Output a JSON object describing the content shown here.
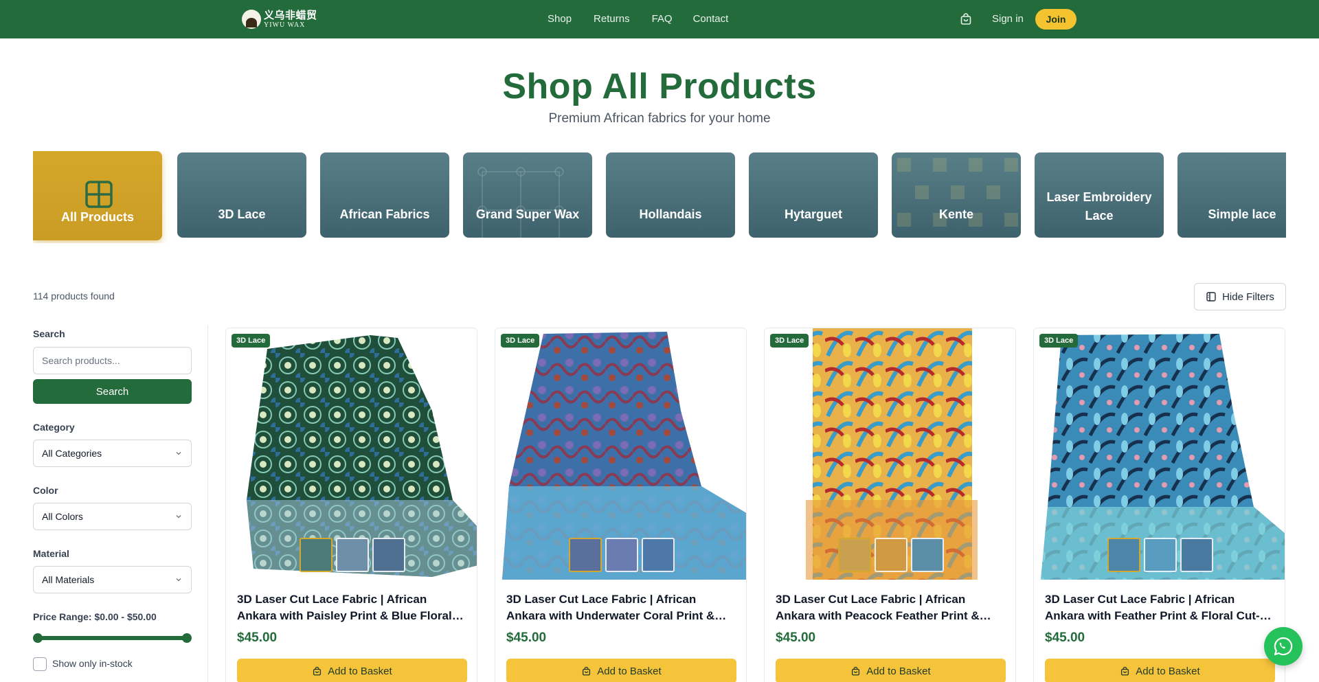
{
  "nav": {
    "logo_cn": "义乌非蜡贸",
    "logo_en": "YIWU WAX",
    "links": [
      "Shop",
      "Returns",
      "FAQ",
      "Contact"
    ],
    "signin": "Sign in",
    "join": "Join"
  },
  "header": {
    "title": "Shop All Products",
    "subtitle": "Premium African fabrics for your home"
  },
  "categories": [
    {
      "label": "All Products",
      "active": true
    },
    {
      "label": "3D Lace"
    },
    {
      "label": "African Fabrics"
    },
    {
      "label": "Grand Super Wax"
    },
    {
      "label": "Hollandais"
    },
    {
      "label": "Hytarguet"
    },
    {
      "label": "Kente"
    },
    {
      "label": "Laser Embroidery Lace"
    },
    {
      "label": "Simple lace"
    }
  ],
  "results": {
    "count": "114 products found",
    "hide_filters": "Hide Filters"
  },
  "filters": {
    "search_label": "Search",
    "search_placeholder": "Search products...",
    "search_button": "Search",
    "category_label": "Category",
    "category_value": "All Categories",
    "color_label": "Color",
    "color_value": "All Colors",
    "material_label": "Material",
    "material_value": "All Materials",
    "price_label": "Price Range: $0.00 - $50.00",
    "price_min": 0,
    "price_max": 50,
    "instock_label": "Show only in-stock",
    "instock_checked": false
  },
  "products": [
    {
      "badge": "3D Lace",
      "title": "3D Laser Cut Lace Fabric | African Ankara with Paisley Print & Blue Floral Cut-Outs",
      "price": "$45.00",
      "button": "Add to Basket"
    },
    {
      "badge": "3D Lace",
      "title": "3D Laser Cut Lace Fabric | African Ankara with Underwater Coral Print & Turquoise Lace",
      "price": "$45.00",
      "button": "Add to Basket"
    },
    {
      "badge": "3D Lace",
      "title": "3D Laser Cut Lace Fabric | African Ankara with Peacock Feather Print & Gold Cut-Outs",
      "price": "$45.00",
      "button": "Add to Basket"
    },
    {
      "badge": "3D Lace",
      "title": "3D Laser Cut Lace Fabric | African Ankara with Feather Print & Floral Cut-Outs",
      "price": "$45.00",
      "button": "Add to Basket"
    }
  ],
  "icons": {
    "basket": "shopping-basket-icon",
    "whatsapp": "whatsapp-icon",
    "grid": "grid-icon",
    "sidebar": "sidebar-panel-icon"
  },
  "colors": {
    "brand_green": "#246b3c",
    "accent_yellow": "#f4c430",
    "active_tile": "#d5a72a",
    "tile": "#4b707a",
    "whatsapp": "#25c15b"
  }
}
